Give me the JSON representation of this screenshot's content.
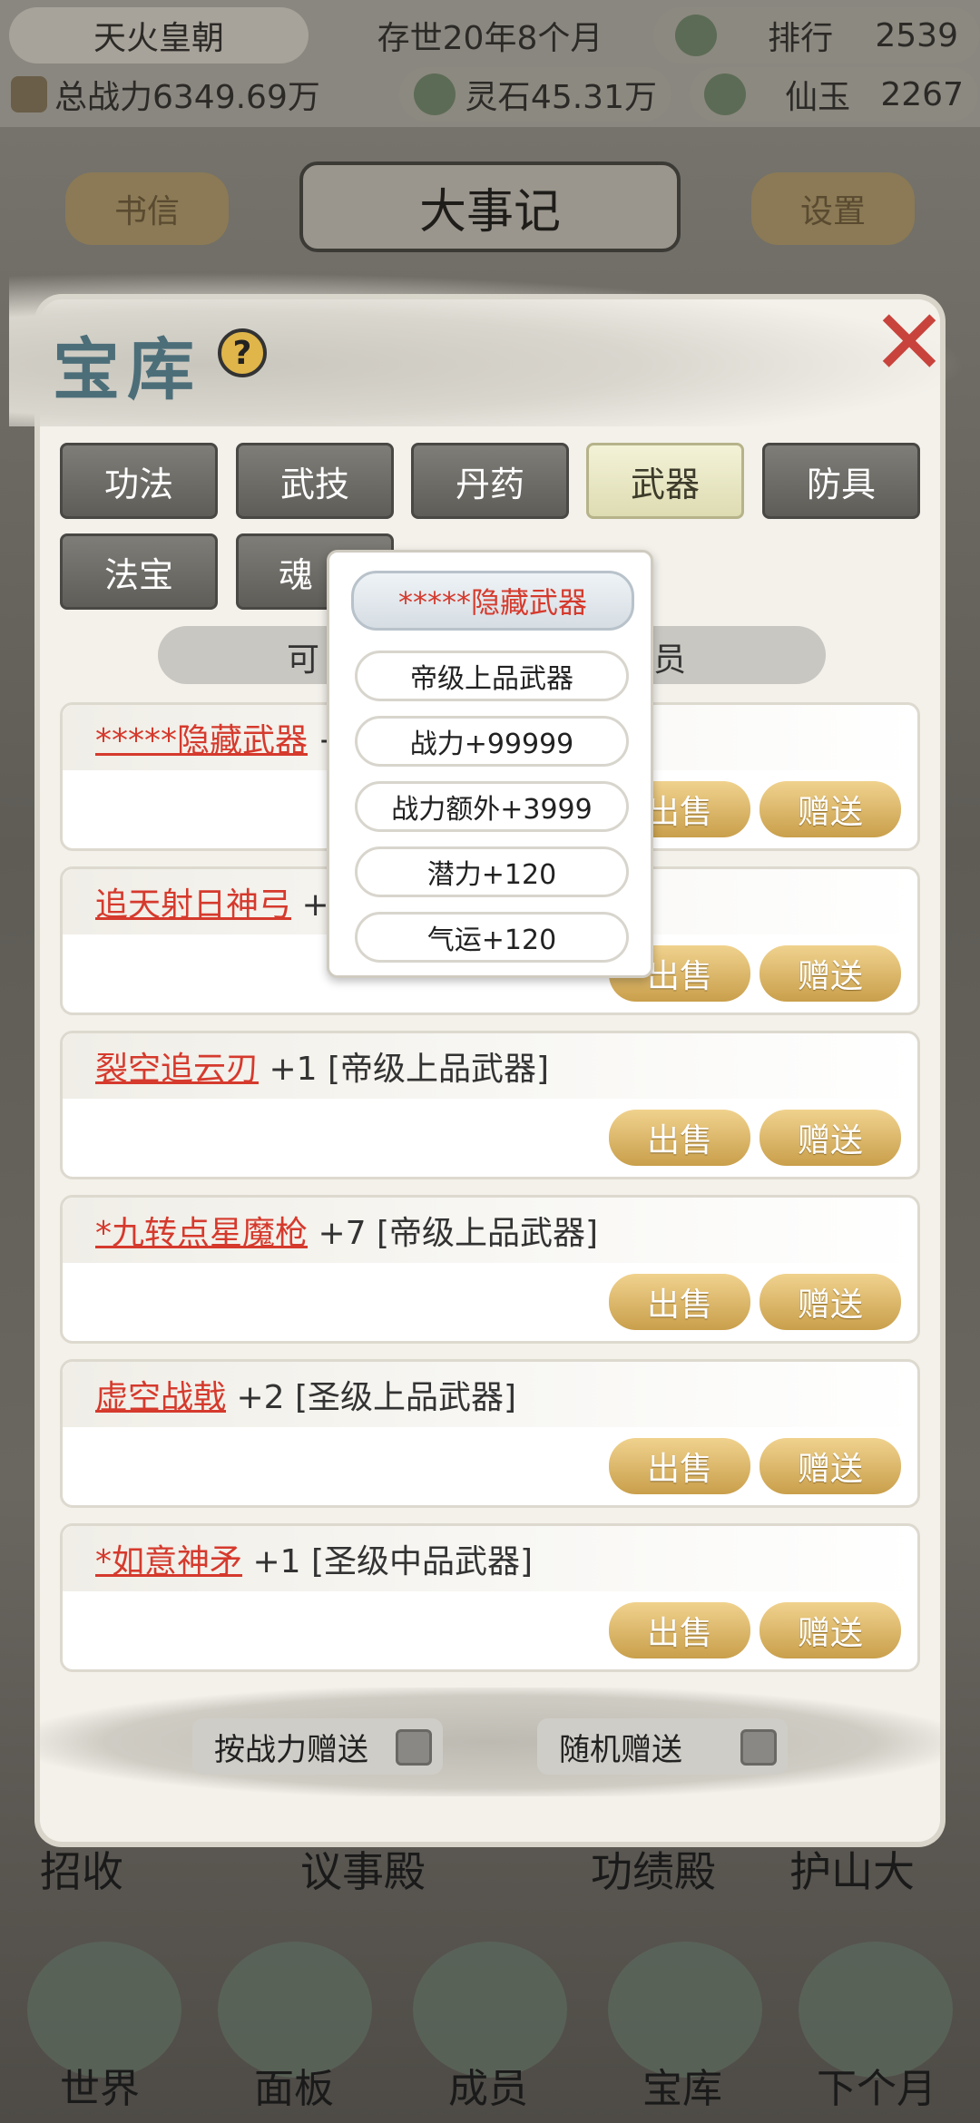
{
  "topbar": {
    "sect_name": "天火皇朝",
    "time": "存世20年8个月",
    "rank_label": "排行",
    "rank_value": "2539",
    "total_power": "总战力6349.69万",
    "stone_label": "灵石",
    "stone_value": "45.31万",
    "jade_label": "仙玉",
    "jade_value": "2267"
  },
  "header": {
    "letter_button": "书信",
    "title": "大事记",
    "settings_button": "设置"
  },
  "dialog": {
    "title": "宝库",
    "help": "?",
    "tabs": [
      {
        "label": "功法"
      },
      {
        "label": "武技"
      },
      {
        "label": "丹药"
      },
      {
        "label": "武器",
        "active": true
      },
      {
        "label": "防具"
      },
      {
        "label": "法宝"
      },
      {
        "label": "魂"
      }
    ],
    "filter_left": "可",
    "filter_right": "员",
    "items": [
      {
        "name": "*****隐藏武器",
        "suffix": " +"
      },
      {
        "name": "追天射日神弓",
        "suffix": " +"
      },
      {
        "name": "裂空追云刃",
        "suffix": " +1 [帝级上品武器]"
      },
      {
        "name": "*九转点星魔枪",
        "suffix": " +7 [帝级上品武器]"
      },
      {
        "name": "虚空战戟",
        "suffix": " +2 [圣级上品武器]"
      },
      {
        "name": "*如意神矛",
        "suffix": " +1 [圣级中品武器]"
      }
    ],
    "sell_label": "出售",
    "gift_label": "赠送",
    "option_power": "按战力赠送",
    "option_random": "随机赠送"
  },
  "tooltip": {
    "title": "*****隐藏武器",
    "lines": [
      "帝级上品武器",
      "战力+99999",
      "战力额外+3999",
      "潜力+120",
      "气运+120"
    ]
  },
  "background_labels": [
    "招收",
    "议事殿",
    "功绩殿",
    "护山大"
  ],
  "bottom_nav": [
    "世界",
    "面板",
    "成员",
    "宝库",
    "下个月"
  ]
}
